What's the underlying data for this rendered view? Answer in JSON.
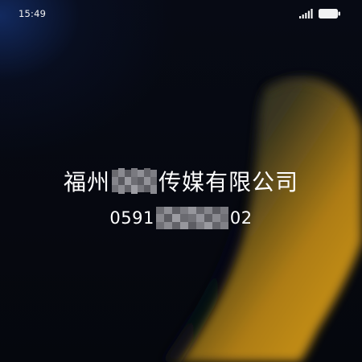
{
  "status_bar": {
    "time": "15:49",
    "icons": [
      "signal-icon",
      "battery-icon"
    ]
  },
  "caller": {
    "name_prefix": "福州",
    "name_suffix": "传媒有限公司",
    "number_prefix": "0591",
    "number_suffix": "02"
  },
  "colors": {
    "text": "#ffffff",
    "background": "#05070d",
    "accent_amber": "#d69e14",
    "accent_blue": "#163478"
  }
}
